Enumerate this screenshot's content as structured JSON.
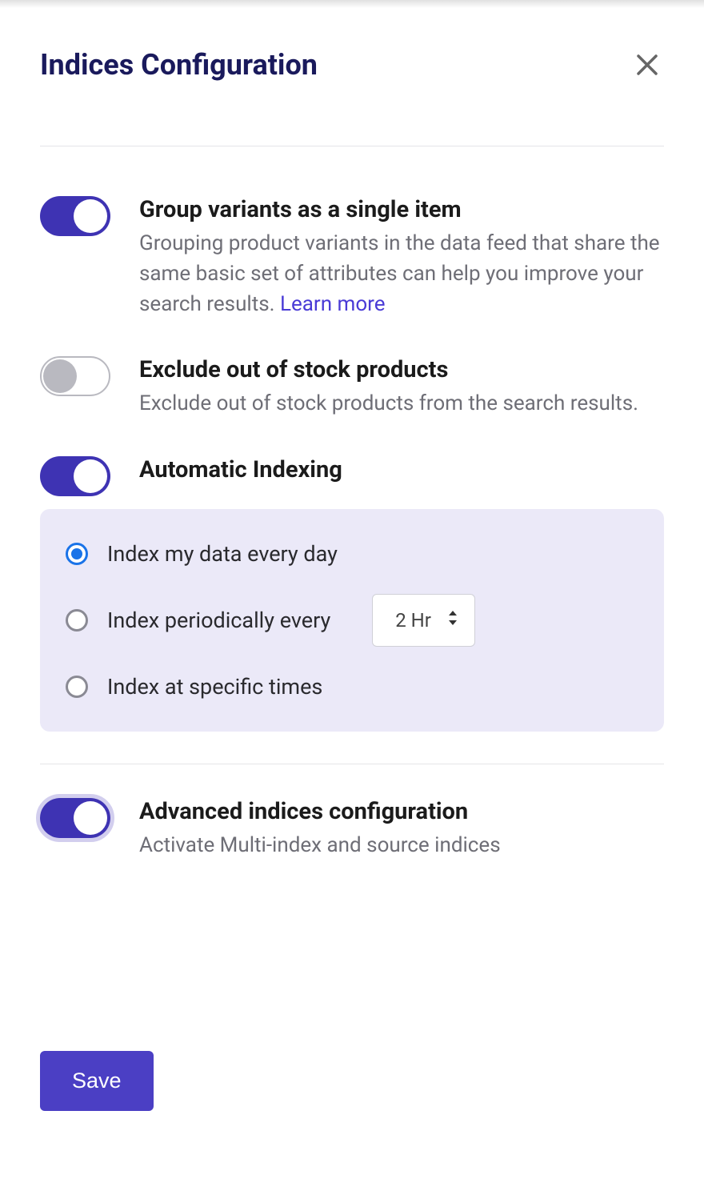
{
  "header": {
    "title": "Indices Configuration"
  },
  "settings": {
    "group_variants": {
      "title": "Group variants as a single item",
      "desc": "Grouping product variants in the data feed that share the same basic set of attributes can help you improve your search results. ",
      "learn_more": "Learn more",
      "enabled": true
    },
    "exclude_oos": {
      "title": "Exclude out of stock products",
      "desc": "Exclude out of stock products from the search results.",
      "enabled": false
    },
    "auto_indexing": {
      "title": "Automatic Indexing",
      "enabled": true,
      "options": {
        "daily": "Index my data every day",
        "periodic": "Index periodically every",
        "periodic_value": "2 Hr",
        "specific": "Index at specific times",
        "selected": "daily"
      }
    },
    "advanced": {
      "title": "Advanced indices configuration",
      "desc": "Activate Multi-index and source indices",
      "enabled": true
    }
  },
  "footer": {
    "save": "Save"
  }
}
